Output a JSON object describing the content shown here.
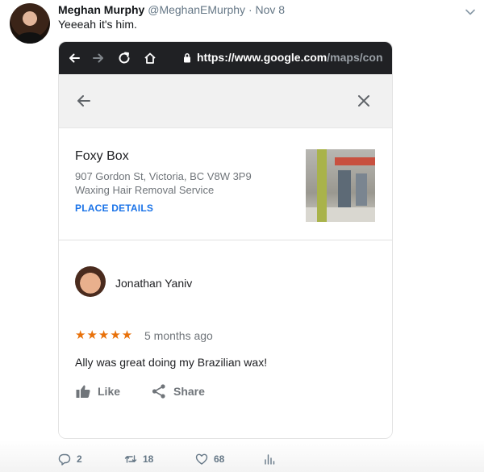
{
  "tweet": {
    "name": "Meghan Murphy",
    "handle": "@MeghanEMurphy",
    "separator": "·",
    "date": "Nov 8",
    "text": "Yeeeah it's him.",
    "actions": {
      "replies": "2",
      "retweets": "18",
      "likes": "68"
    }
  },
  "browser": {
    "url_main": "https://www.google.com",
    "url_path": "/maps/con"
  },
  "place": {
    "name": "Foxy Box",
    "address": "907 Gordon St, Victoria, BC V8W 3P9",
    "category": "Waxing Hair Removal Service",
    "details_link": "PLACE DETAILS"
  },
  "review": {
    "reviewer": "Jonathan Yaniv",
    "rating": 5,
    "stars_text": "★★★★★",
    "time": "5 months ago",
    "text": "Ally was great doing my Brazilian wax!",
    "like_label": "Like",
    "share_label": "Share"
  },
  "colors": {
    "browser_bar": "#202124",
    "link_blue": "#1a73e8",
    "star_orange": "#e8710a",
    "twitter_gray": "#657786"
  },
  "icons": [
    "chevron-down-icon",
    "back-icon",
    "forward-icon",
    "reload-icon",
    "home-icon",
    "lock-icon",
    "back-arrow-icon",
    "close-icon",
    "thumbs-up-icon",
    "share-icon",
    "reply-icon",
    "retweet-icon",
    "heart-icon",
    "analytics-icon"
  ]
}
